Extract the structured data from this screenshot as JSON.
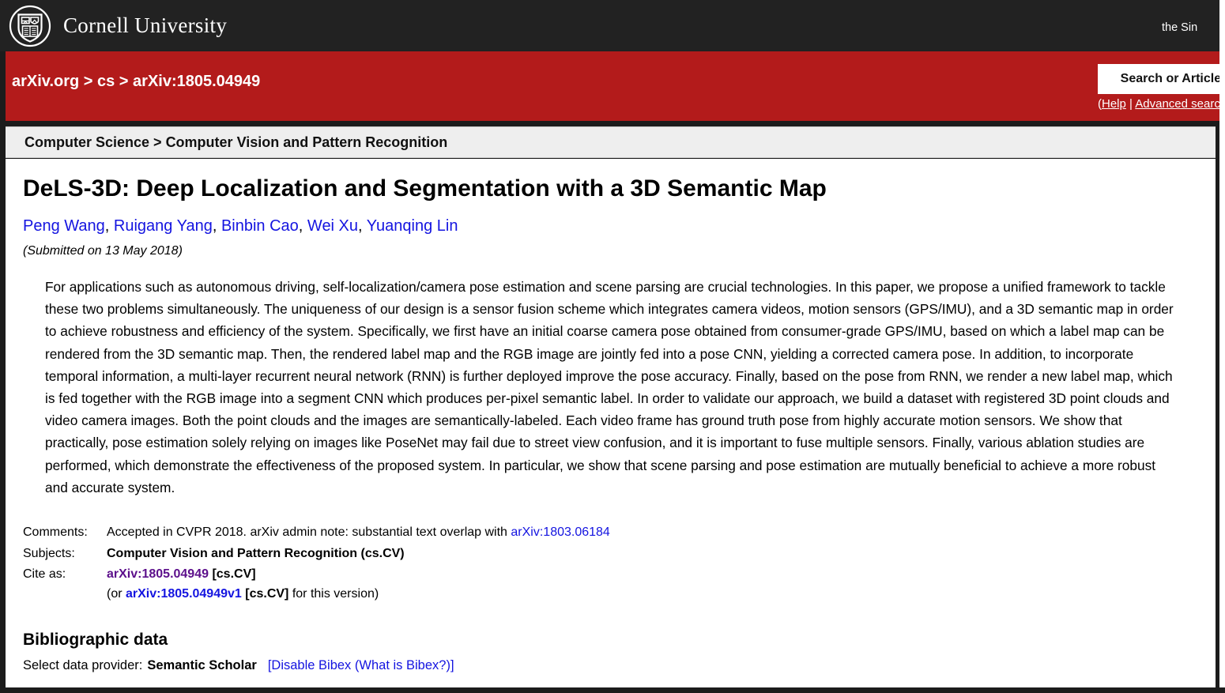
{
  "window": {
    "background_color": "#1c1c1c"
  },
  "cornell_header": {
    "background_color": "#222222",
    "logo_icon": "cornell-seal-icon",
    "wordmark": "Cornell University",
    "acknowledgement_partial": "the Sin"
  },
  "arxiv_banner": {
    "background_color": "#b31b1b",
    "breadcrumb": "arXiv.org > cs > arXiv:1805.04949",
    "breadcrumb_parts": [
      "arXiv.org",
      "cs",
      "arXiv:1805.04949"
    ],
    "search_placeholder": "Search or Article I",
    "search_full_label": "Search or Article ID",
    "help_link": "Help",
    "separator": " | ",
    "advanced_search_link": "Advanced search",
    "links_prefix": "(",
    "links_suffix": ")"
  },
  "subject_bar": {
    "background_color": "#eeeeee",
    "primary": "Computer Science",
    "separator": " > ",
    "secondary": "Computer Vision and Pattern Recognition",
    "full": "Computer Science > Computer Vision and Pattern Recognition"
  },
  "paper": {
    "title": "DeLS-3D: Deep Localization and Segmentation with a 3D Semantic Map",
    "authors": [
      "Peng Wang",
      "Ruigang Yang",
      "Binbin Cao",
      "Wei Xu",
      "Yuanqing Lin"
    ],
    "authors_joined": "Peng Wang, Ruigang Yang, Binbin Cao, Wei Xu, Yuanqing Lin",
    "submitted": "(Submitted on 13 May 2018)",
    "abstract": "For applications such as autonomous driving, self-localization/camera pose estimation and scene parsing are crucial technologies. In this paper, we propose a unified framework to tackle these two problems simultaneously. The uniqueness of our design is a sensor fusion scheme which integrates camera videos, motion sensors (GPS/IMU), and a 3D semantic map in order to achieve robustness and efficiency of the system. Specifically, we first have an initial coarse camera pose obtained from consumer-grade GPS/IMU, based on which a label map can be rendered from the 3D semantic map. Then, the rendered label map and the RGB image are jointly fed into a pose CNN, yielding a corrected camera pose. In addition, to incorporate temporal information, a multi-layer recurrent neural network (RNN) is further deployed improve the pose accuracy. Finally, based on the pose from RNN, we render a new label map, which is fed together with the RGB image into a segment CNN which produces per-pixel semantic label. In order to validate our approach, we build a dataset with registered 3D point clouds and video camera images. Both the point clouds and the images are semantically-labeled. Each video frame has ground truth pose from highly accurate motion sensors. We show that practically, pose estimation solely relying on images like PoseNet may fail due to street view confusion, and it is important to fuse multiple sensors. Finally, various ablation studies are performed, which demonstrate the effectiveness of the proposed system. In particular, we show that scene parsing and pose estimation are mutually beneficial to achieve a more robust and accurate system."
  },
  "metadata": {
    "comments_label": "Comments:",
    "comments_text": "Accepted in CVPR 2018. arXiv admin note: substantial text overlap with ",
    "comments_link": "arXiv:1803.06184",
    "subjects_label": "Subjects:",
    "subjects_value": "Computer Vision and Pattern Recognition (cs.CV)",
    "cite_label": "Cite as:",
    "cite_id": "arXiv:1805.04949",
    "cite_category": "[cs.CV]",
    "cite_version_prefix": "(or ",
    "cite_version_id": "arXiv:1805.04949v1",
    "cite_version_category": "[cs.CV]",
    "cite_version_suffix": " for this version)"
  },
  "bibliographic": {
    "heading": "Bibliographic data",
    "select_label": "Select data provider:",
    "provider": "Semantic Scholar",
    "open_bracket": "[",
    "disable_link": "Disable Bibex",
    "what_is_open": " (",
    "what_is_link": "What is Bibex?",
    "what_is_close": ")",
    "close_bracket": "]"
  },
  "colors": {
    "cornell_red": "#b31b1b",
    "header_black": "#222222",
    "link_blue": "#1414e0",
    "visited_purple": "#5c0f8b",
    "subject_gray": "#eeeeee"
  }
}
